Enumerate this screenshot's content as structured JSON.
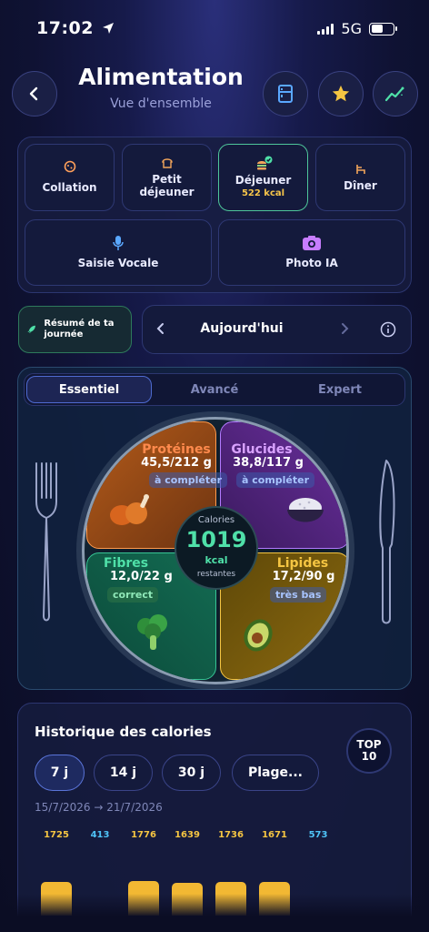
{
  "status": {
    "time": "17:02",
    "network": "5G"
  },
  "header": {
    "title": "Alimentation",
    "subtitle": "Vue d'ensemble"
  },
  "icons": {
    "back": "chevron-left-icon",
    "fridge": "fridge-icon",
    "favorites": "star-icon",
    "trends": "trend-line-icon"
  },
  "meals": [
    {
      "label": "Collation",
      "icon": "cookie-icon",
      "kcal": ""
    },
    {
      "label": "Petit\ndéjeuner",
      "icon": "toast-icon",
      "kcal": ""
    },
    {
      "label": "Déjeuner",
      "icon": "burger-check-icon",
      "kcal": "522 kcal"
    },
    {
      "label": "Dîner",
      "icon": "chair-icon",
      "kcal": ""
    }
  ],
  "inputs": {
    "voice": "Saisie Vocale",
    "photo": "Photo IA"
  },
  "summary_button": "Résumé de ta journée",
  "date_nav": {
    "label": "Aujourd'hui"
  },
  "tabs": [
    "Essentiel",
    "Avancé",
    "Expert"
  ],
  "active_tab": 0,
  "plate": {
    "center": {
      "top": "Calories",
      "value": "1019",
      "unit": "kcal",
      "bottom": "restantes"
    },
    "proteins": {
      "name": "Protéines",
      "amount": "45,5/212 g",
      "status": "à compléter"
    },
    "carbs": {
      "name": "Glucides",
      "amount": "38,8/117 g",
      "status": "à compléter"
    },
    "fibers": {
      "name": "Fibres",
      "amount": "12,0/22 g",
      "status": "correct"
    },
    "fats": {
      "name": "Lipides",
      "amount": "17,2/90 g",
      "status": "très bas"
    }
  },
  "colors": {
    "proteins": "#ff8a4d",
    "carbs": "#c77dff",
    "fibers": "#4fe0a8",
    "fats": "#f5c542",
    "accent": "#4e6bd0"
  },
  "history": {
    "title": "Historique des calories",
    "top_badge": "TOP\n10",
    "ranges": [
      "7 j",
      "14 j",
      "30 j",
      "Plage..."
    ],
    "active_range": 0,
    "date_range": "15/7/2026 → 21/7/2026",
    "values": [
      1725,
      413,
      1776,
      1639,
      1736,
      1671,
      573
    ],
    "value_colors": [
      "#f5c542",
      "#4fc3f7",
      "#f5c542",
      "#f5c542",
      "#f5c542",
      "#f5c542",
      "#4fc3f7"
    ]
  }
}
